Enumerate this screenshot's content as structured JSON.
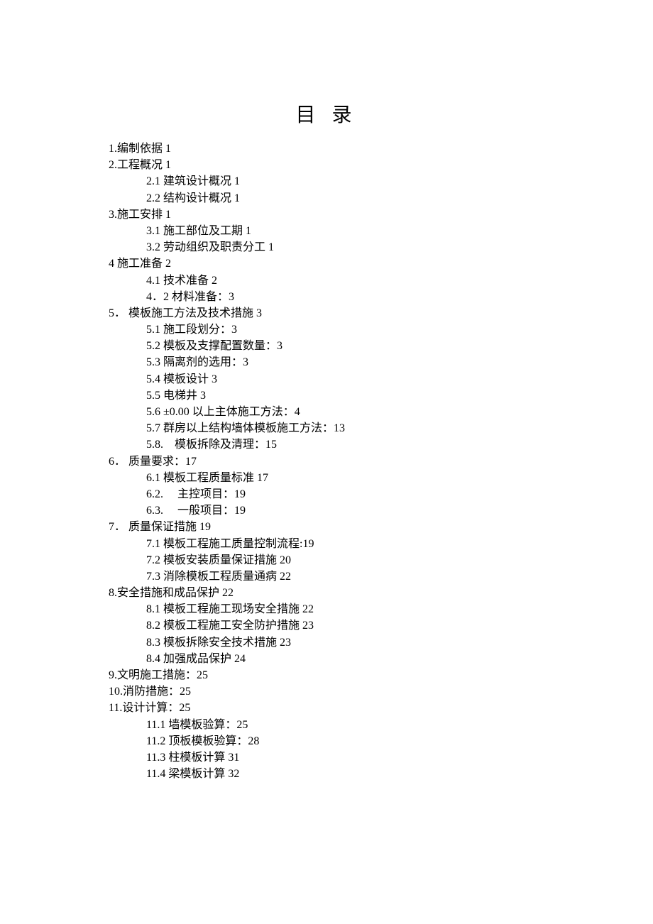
{
  "title": "目 录",
  "entries": [
    {
      "level": 1,
      "text": "1.编制依据 1"
    },
    {
      "level": 1,
      "text": "2.工程概况 1"
    },
    {
      "level": 2,
      "text": "2.1 建筑设计概况 1"
    },
    {
      "level": 2,
      "text": "2.2 结构设计概况 1"
    },
    {
      "level": 1,
      "text": "3.施工安排 1"
    },
    {
      "level": 2,
      "text": "3.1 施工部位及工期 1"
    },
    {
      "level": 2,
      "text": "3.2 劳动组织及职责分工 1"
    },
    {
      "level": 1,
      "text": "4 施工准备 2"
    },
    {
      "level": 2,
      "text": "4.1 技术准备 2"
    },
    {
      "level": 2,
      "text": "4．2 材料准备：3"
    },
    {
      "level": 1,
      "text": "5． 模板施工方法及技术措施 3"
    },
    {
      "level": 2,
      "text": "5.1 施工段划分：3"
    },
    {
      "level": 2,
      "text": "5.2 模板及支撑配置数量：3"
    },
    {
      "level": 2,
      "text": "5.3 隔离剂的选用：3"
    },
    {
      "level": 2,
      "text": "5.4 模板设计 3"
    },
    {
      "level": 2,
      "text": "5.5 电梯井 3"
    },
    {
      "level": 2,
      "text": "5.6  ±0.00 以上主体施工方法：4"
    },
    {
      "level": 2,
      "text": "5.7 群房以上结构墙体模板施工方法：13"
    },
    {
      "level": 2,
      "text": "5.8.　模板拆除及清理：15"
    },
    {
      "level": 1,
      "text": "6． 质量要求：17"
    },
    {
      "level": 2,
      "text": "6.1 模板工程质量标准 17"
    },
    {
      "level": 2,
      "text": "6.2.　 主控项目：19"
    },
    {
      "level": 2,
      "text": "6.3.　 一般项目：19"
    },
    {
      "level": 1,
      "text": "7． 质量保证措施 19"
    },
    {
      "level": 2,
      "text": "7.1 模板工程施工质量控制流程:19"
    },
    {
      "level": 2,
      "text": "7.2 模板安装质量保证措施 20"
    },
    {
      "level": 2,
      "text": "7.3 消除模板工程质量通病 22"
    },
    {
      "level": 1,
      "text": "8.安全措施和成品保护 22"
    },
    {
      "level": 2,
      "text": "8.1 模板工程施工现场安全措施 22"
    },
    {
      "level": 2,
      "text": "8.2 模板工程施工安全防护措施 23"
    },
    {
      "level": 2,
      "text": "8.3 模板拆除安全技术措施 23"
    },
    {
      "level": 2,
      "text": "8.4 加强成品保护 24"
    },
    {
      "level": 1,
      "text": "9.文明施工措施：25"
    },
    {
      "level": 1,
      "text": "10.消防措施：25"
    },
    {
      "level": 1,
      "text": "11.设计计算：25"
    },
    {
      "level": 2,
      "text": "11.1 墙模板验算：25"
    },
    {
      "level": 2,
      "text": "11.2 顶板模板验算：28"
    },
    {
      "level": 2,
      "text": "11.3 柱模板计算 31"
    },
    {
      "level": 2,
      "text": "11.4 梁模板计算 32"
    }
  ]
}
